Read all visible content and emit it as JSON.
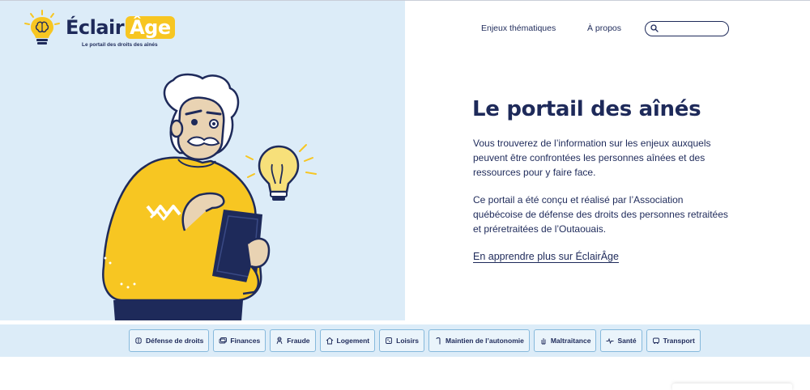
{
  "brand": {
    "word": "Éclair",
    "word_highlight": "Âge",
    "tagline": "Le portail des droits des aînés",
    "accent": "#f7c622",
    "navy": "#1e2a5a"
  },
  "nav": {
    "items": [
      {
        "label": "Enjeux thématiques"
      },
      {
        "label": "À propos"
      }
    ],
    "search": {
      "placeholder": "",
      "value": "",
      "icon": "search-icon"
    }
  },
  "hero": {
    "title": "Le portail des aînés",
    "paragraphs": [
      "Vous trouverez de l’information sur les enjeux auxquels peuvent être confrontées les personnes aînées et des ressources pour y faire face.",
      "Ce portail a été conçu et réalisé par l’Association québécoise de défense des droits des personnes retraitées et préretraitées de l’Outaouais."
    ],
    "link": "En apprendre plus sur ÉclairÂge",
    "background": "#dcecf8"
  },
  "categories": [
    {
      "label": "Défense de droits",
      "icon": "brain-icon"
    },
    {
      "label": "Finances",
      "icon": "money-icon"
    },
    {
      "label": "Fraude",
      "icon": "thief-icon"
    },
    {
      "label": "Logement",
      "icon": "house-icon"
    },
    {
      "label": "Loisirs",
      "icon": "leisure-icon"
    },
    {
      "label": "Maintien de l’autonomie",
      "icon": "cane-icon"
    },
    {
      "label": "Maltraitance",
      "icon": "hand-icon"
    },
    {
      "label": "Santé",
      "icon": "heartbeat-icon"
    },
    {
      "label": "Transport",
      "icon": "bus-icon"
    }
  ]
}
